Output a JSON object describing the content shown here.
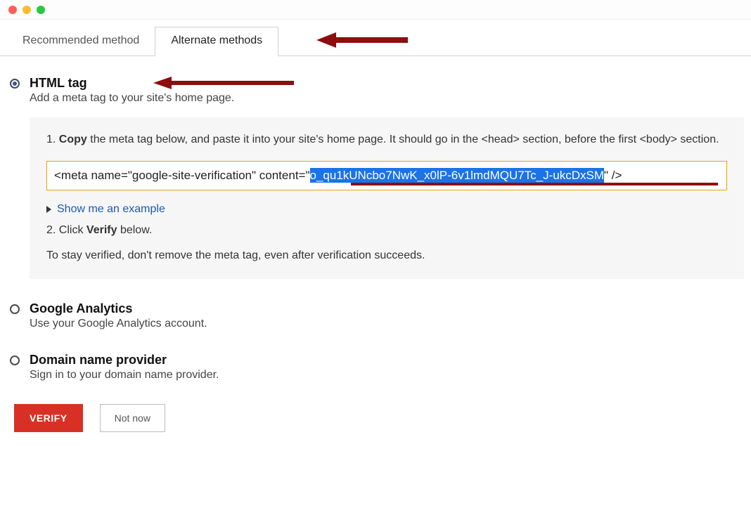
{
  "tabs": {
    "recommended": "Recommended method",
    "alternate": "Alternate methods"
  },
  "html_tag": {
    "title": "HTML tag",
    "subtitle": "Add a meta tag to your site's home page.",
    "step1_a": "1. ",
    "step1_b": "Copy",
    "step1_c": " the meta tag below, and paste it into your site's home page. It should go in the <head> section, before the first <body> section.",
    "code_prefix": "<meta name=\"google-site-verification\" content=\"",
    "code_highlight": "o_qu1kUNcbo7NwK_x0lP-6v1lmdMQU7Tc_J-ukcDxSM",
    "code_suffix": "\" />",
    "show_example": "Show me an example",
    "step2_a": "2. Click ",
    "step2_b": "Verify",
    "step2_c": " below.",
    "note": "To stay verified, don't remove the meta tag, even after verification succeeds."
  },
  "ga": {
    "title": "Google Analytics",
    "subtitle": "Use your Google Analytics account."
  },
  "dnp": {
    "title": "Domain name provider",
    "subtitle": "Sign in to your domain name provider."
  },
  "actions": {
    "verify": "VERIFY",
    "notnow": "Not now"
  }
}
